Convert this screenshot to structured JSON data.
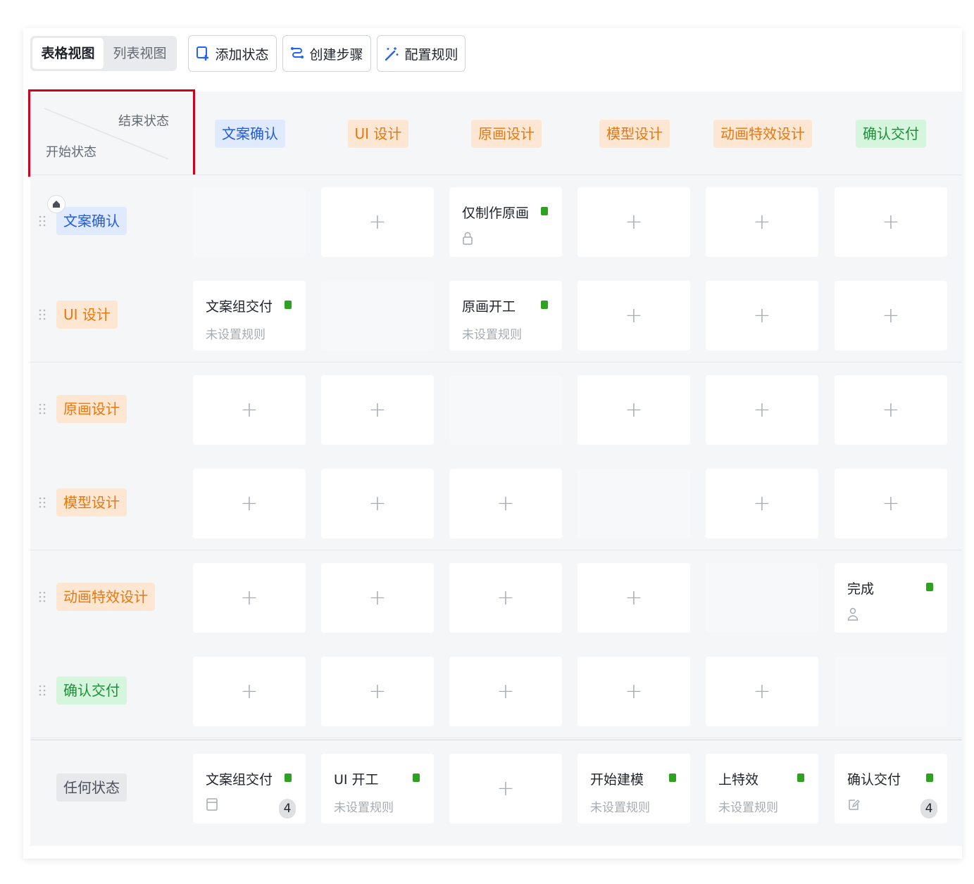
{
  "toolbar": {
    "view_table": "表格视图",
    "view_list": "列表视图",
    "add_status": "添加状态",
    "create_steps": "创建步骤",
    "config_rules": "配置规则"
  },
  "corner": {
    "end_label": "结束状态",
    "start_label": "开始状态"
  },
  "columns": [
    {
      "label": "文案确认",
      "color": "blue"
    },
    {
      "label": "UI 设计",
      "color": "orange"
    },
    {
      "label": "原画设计",
      "color": "orange"
    },
    {
      "label": "模型设计",
      "color": "orange"
    },
    {
      "label": "动画特效设计",
      "color": "orange"
    },
    {
      "label": "确认交付",
      "color": "green"
    }
  ],
  "rows": [
    {
      "label": "文案确认",
      "color": "blue",
      "home": true
    },
    {
      "label": "UI 设计",
      "color": "orange"
    },
    {
      "label": "原画设计",
      "color": "orange"
    },
    {
      "label": "模型设计",
      "color": "orange"
    },
    {
      "label": "动画特效设计",
      "color": "orange"
    },
    {
      "label": "确认交付",
      "color": "green"
    }
  ],
  "any_row": {
    "label": "任何状态"
  },
  "cells": {
    "r0c2": {
      "title": "仅制作原画",
      "icon": "lock-icon"
    },
    "r1c0": {
      "title": "文案组交付",
      "sub": "未设置规则"
    },
    "r1c2": {
      "title": "原画开工",
      "sub": "未设置规则"
    },
    "r4c5": {
      "title": "完成",
      "icon": "user-icon"
    },
    "a0": {
      "title": "文案组交付",
      "icon": "form-icon",
      "count": "4"
    },
    "a1": {
      "title": "UI 开工",
      "sub": "未设置规则"
    },
    "a3": {
      "title": "开始建模",
      "sub": "未设置规则"
    },
    "a4": {
      "title": "上特效",
      "sub": "未设置规则"
    },
    "a5": {
      "title": "确认交付",
      "icon": "edit-icon",
      "count": "4"
    }
  },
  "colors": {
    "blue_tag_bg": "#dfeaff",
    "blue_tag_text": "#245bdb",
    "orange_tag_bg": "#fee7d2",
    "orange_tag_text": "#e8770d",
    "green_tag_bg": "#d5f5dc",
    "green_tag_text": "#1f8f3b",
    "status_dot": "#2ea121",
    "highlight_border": "#d0021b"
  }
}
